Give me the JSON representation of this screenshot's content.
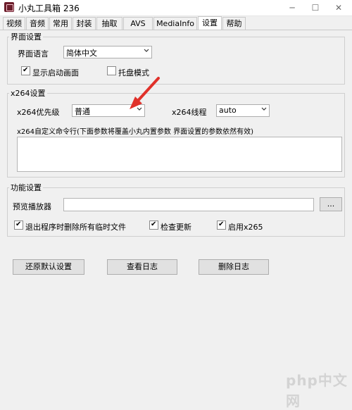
{
  "window": {
    "title": "小丸工具箱 236",
    "min_icon": "minimize-icon",
    "max_icon": "maximize-icon",
    "close_icon": "close-icon"
  },
  "tabs": [
    {
      "label": "视频"
    },
    {
      "label": "音频"
    },
    {
      "label": "常用"
    },
    {
      "label": "封装"
    },
    {
      "label": "抽取"
    },
    {
      "label": "AVS"
    },
    {
      "label": "MediaInfo"
    },
    {
      "label": "设置"
    },
    {
      "label": "帮助"
    }
  ],
  "active_tab": "设置",
  "interface": {
    "legend": "界面设置",
    "language_label": "界面语言",
    "language_value": "简体中文",
    "splash_label": "显示启动画面",
    "splash_checked": true,
    "tray_label": "托盘模式",
    "tray_checked": false
  },
  "x264": {
    "legend": "x264设置",
    "priority_label": "x264优先级",
    "priority_value": "普通",
    "threads_label": "x264线程",
    "threads_value": "auto",
    "custom_label": "x264自定义命令行(下面参数将覆盖小丸内置参数 界面设置的参数依然有效)",
    "custom_value": ""
  },
  "features": {
    "legend": "功能设置",
    "player_label": "预览播放器",
    "player_value": "",
    "browse_label": "...",
    "delete_temp_label": "退出程序时删除所有临时文件",
    "delete_temp_checked": true,
    "check_update_label": "检查更新",
    "check_update_checked": true,
    "x265_label": "启用x265",
    "x265_checked": true
  },
  "buttons": {
    "reset": "还原默认设置",
    "view_log": "查看日志",
    "delete_log": "删除日志"
  },
  "watermark": "php中文网",
  "colors": {
    "annotation_arrow": "#e0312a"
  }
}
